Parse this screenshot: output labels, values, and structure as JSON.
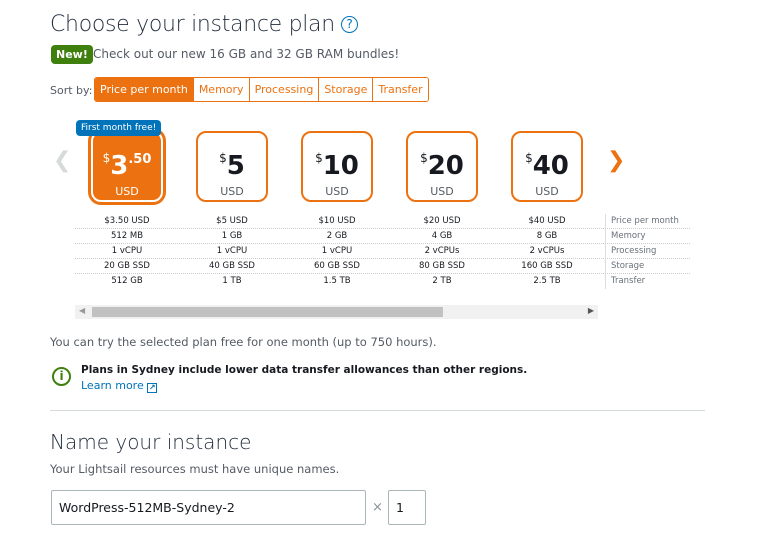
{
  "title": "Choose your instance plan",
  "help_icon": "?",
  "new_badge": "New!",
  "new_text": "Check out our new 16 GB and 32 GB RAM bundles!",
  "sort": {
    "label": "Sort by:",
    "options": [
      "Price per month",
      "Memory",
      "Processing",
      "Storage",
      "Transfer"
    ],
    "active": "Price per month"
  },
  "first_month_badge": "First month free!",
  "accent": "#ec7211",
  "plans": [
    {
      "symbol": "$",
      "whole": "3",
      "cents": ".50",
      "currency": "USD",
      "price": "$3.50 USD",
      "memory": "512 MB",
      "processing": "1 vCPU",
      "storage": "20 GB SSD",
      "transfer": "512 GB",
      "selected": true
    },
    {
      "symbol": "$",
      "whole": "5",
      "cents": "",
      "currency": "USD",
      "price": "$5 USD",
      "memory": "1 GB",
      "processing": "1 vCPU",
      "storage": "40 GB SSD",
      "transfer": "1 TB"
    },
    {
      "symbol": "$",
      "whole": "10",
      "cents": "",
      "currency": "USD",
      "price": "$10 USD",
      "memory": "2 GB",
      "processing": "1 vCPU",
      "storage": "60 GB SSD",
      "transfer": "1.5 TB"
    },
    {
      "symbol": "$",
      "whole": "20",
      "cents": "",
      "currency": "USD",
      "price": "$20 USD",
      "memory": "4 GB",
      "processing": "2 vCPUs",
      "storage": "80 GB SSD",
      "transfer": "2 TB"
    },
    {
      "symbol": "$",
      "whole": "40",
      "cents": "",
      "currency": "USD",
      "price": "$40 USD",
      "memory": "8 GB",
      "processing": "2 vCPUs",
      "storage": "160 GB SSD",
      "transfer": "2.5 TB"
    }
  ],
  "row_labels": {
    "price": "Price per month",
    "memory": "Memory",
    "processing": "Processing",
    "storage": "Storage",
    "transfer": "Transfer"
  },
  "trial_note": "You can try the selected plan free for one month (up to 750 hours).",
  "info": {
    "text": "Plans in Sydney include lower data transfer allowances than other regions.",
    "link": "Learn more"
  },
  "name_section": {
    "title": "Name your instance",
    "subtitle": "Your Lightsail resources must have unique names.",
    "name_value": "WordPress-512MB-Sydney-2",
    "times": "×",
    "count_value": "1"
  }
}
